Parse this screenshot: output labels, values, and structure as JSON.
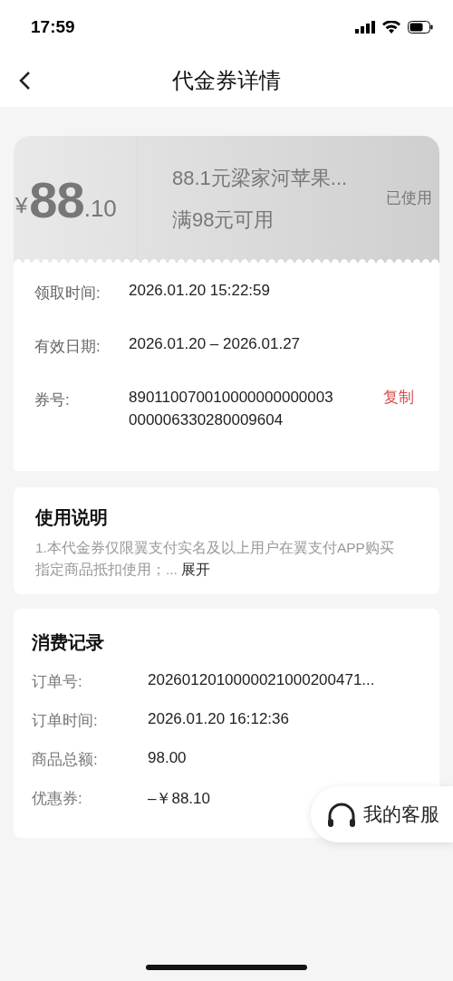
{
  "status_bar": {
    "time": "17:59"
  },
  "nav": {
    "title": "代金券详情"
  },
  "coupon": {
    "currency": "¥",
    "amount": "88",
    "decimals": ".10",
    "title": "88.1元梁家河苹果...",
    "condition": "满98元可用",
    "status": "已使用",
    "used": true
  },
  "details": [
    {
      "label": "领取时间:",
      "value": "2026.01.20 15:22:59"
    },
    {
      "label": "有效日期:",
      "value": "2026.01.20 – 2026.01.27"
    },
    {
      "label": "券号:",
      "value": "890110070010000000000003000006330280009604",
      "action": "复制"
    }
  ],
  "usage": {
    "title": "使用说明",
    "text": "1.本代金券仅限翼支付实名及以上用户在翼支付APP购买指定商品抵扣使用；... ",
    "expand": "展开"
  },
  "records": {
    "title": "消费记录",
    "rows": [
      {
        "label": "订单号:",
        "value": "2026012010000021000200471..."
      },
      {
        "label": "订单时间:",
        "value": "2026.01.20 16:12:36"
      },
      {
        "label": "商品总额:",
        "value": "98.00"
      },
      {
        "label": "优惠券:",
        "value": "–￥88.10"
      }
    ]
  },
  "support": {
    "label": "我的客服"
  }
}
